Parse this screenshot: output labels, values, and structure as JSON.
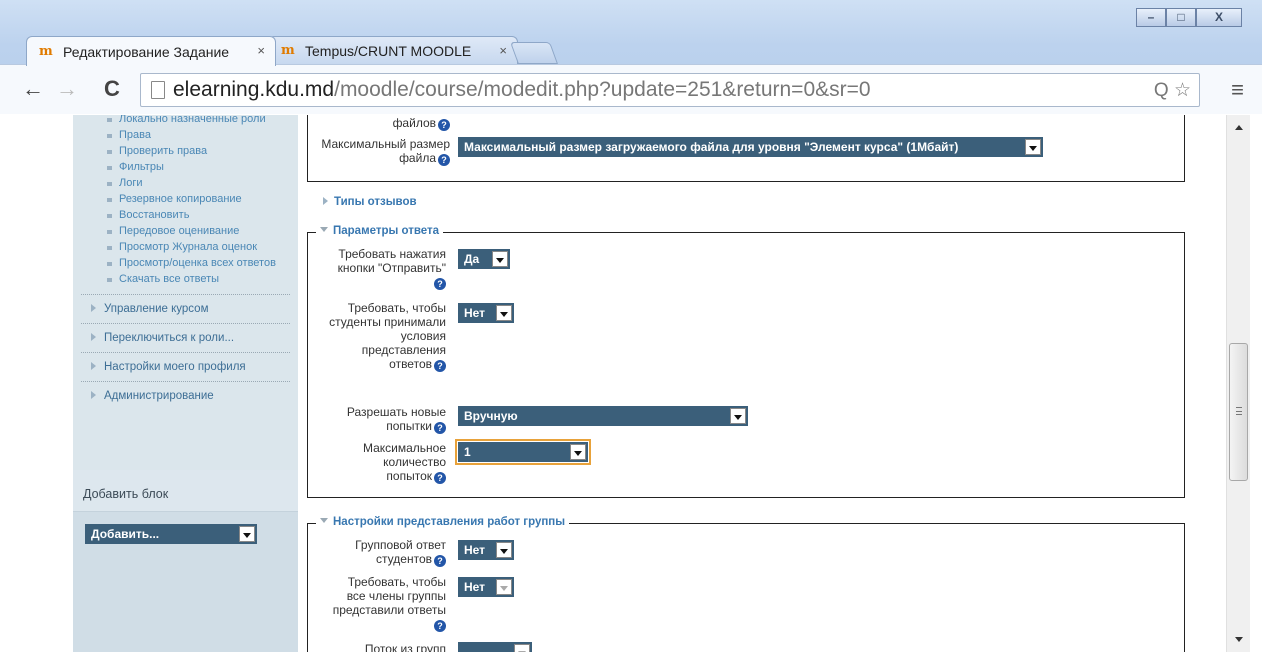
{
  "browser": {
    "tabs": [
      {
        "title": "Редактирование Задание",
        "close": "×"
      },
      {
        "title": "Tempus/CRUNT MOODLE",
        "close": "×"
      }
    ],
    "window_controls": {
      "minimize": "–",
      "maximize": "□",
      "close": "X"
    },
    "url_host": "elearning.kdu.md",
    "url_path": "/moodle/course/modedit.php?update=251&return=0&sr=0",
    "nav": {
      "back": "←",
      "forward": "→",
      "reload": "C"
    },
    "omni_icons": "Q ☆",
    "menu": "≡"
  },
  "sidebar": {
    "sub_items": [
      "Локально назначенные роли",
      "Права",
      "Проверить права",
      "Фильтры",
      "Логи",
      "Резервное копирование",
      "Восстановить",
      "Передовое оценивание",
      "Просмотр Журнала оценок",
      "Просмотр/оценка всех ответов",
      "Скачать все ответы"
    ],
    "sections": [
      "Управление курсом",
      "Переключиться к роли...",
      "Настройки моего профиля",
      "Администрирование"
    ],
    "add_block": {
      "title": "Добавить блок",
      "select": "Добавить..."
    }
  },
  "form": {
    "files_label_tail": "файлов",
    "max_size_label": "Максимальный размер файла",
    "max_size_value": "Максимальный размер загружаемого файла для уровня \"Элемент курса\" (1Мбайт)",
    "feedback_types": "Типы отзывов",
    "answer_params": {
      "legend": "Параметры ответа",
      "require_submit_label": "Требовать нажатия кнопки \"Отправить\"",
      "require_submit_value": "Да",
      "require_accept_label": "Требовать, чтобы студенты принимали условия представления ответов",
      "require_accept_value": "Нет",
      "allow_attempts_label": "Разрешать новые попытки",
      "allow_attempts_value": "Вручную",
      "max_attempts_label": "Максимальное количество попыток",
      "max_attempts_value": "1"
    },
    "group_settings": {
      "legend": "Настройки представления работ группы",
      "group_answer_label": "Групповой ответ студентов",
      "group_answer_value": "Нет",
      "all_members_label": "Требовать, чтобы все члены группы представили ответы",
      "all_members_value": "Нет",
      "grouping_label": "Поток из групп"
    },
    "help": "?"
  }
}
